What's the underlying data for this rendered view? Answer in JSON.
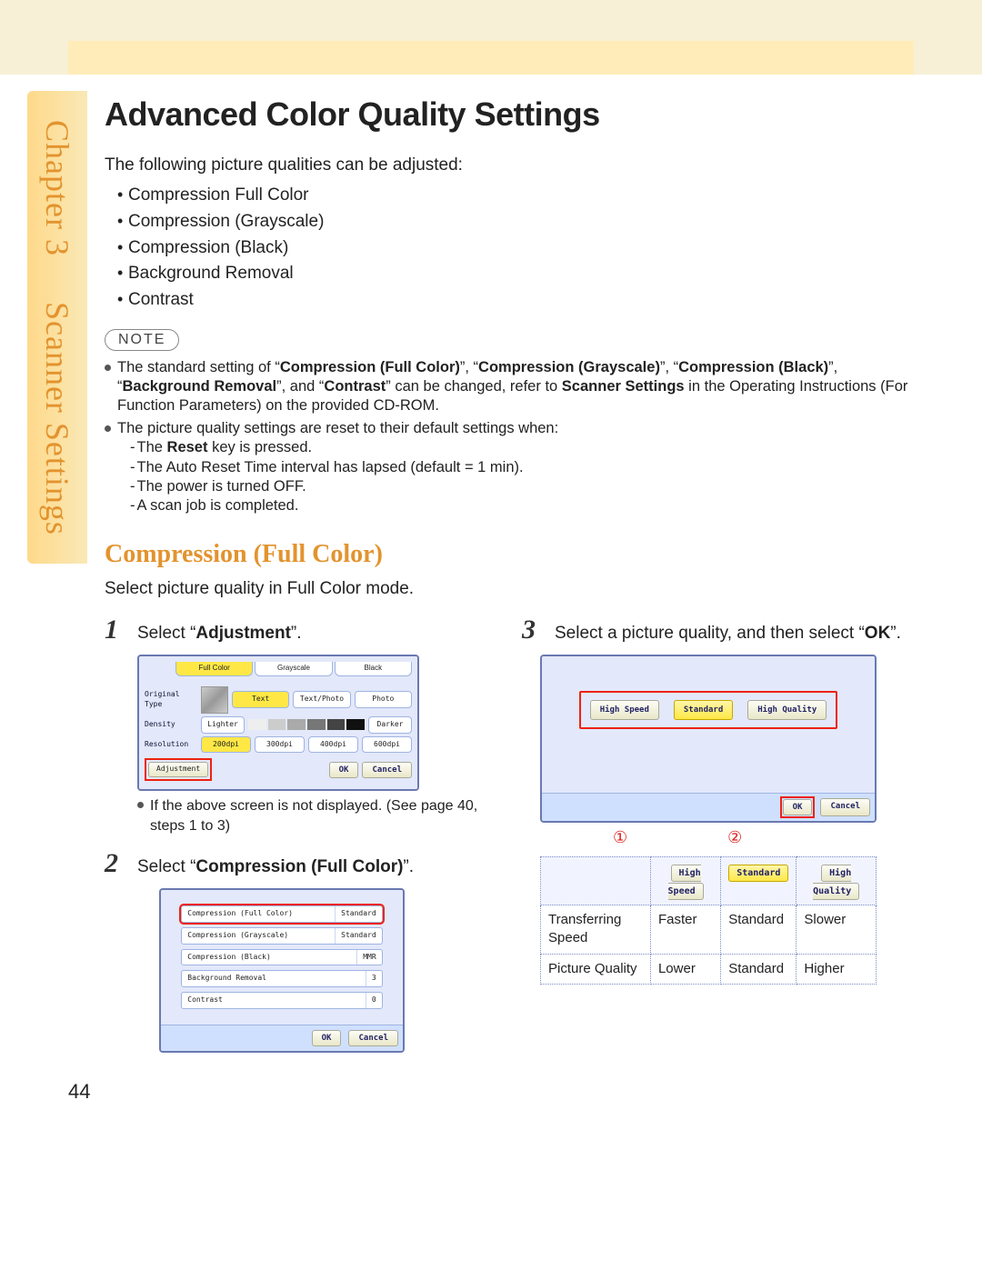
{
  "chapter": {
    "label": "Chapter 3",
    "section": "Scanner Settings"
  },
  "title": "Advanced Color Quality Settings",
  "intro": "The following picture qualities can be adjusted:",
  "quality_list": [
    "Compression Full Color",
    "Compression (Grayscale)",
    "Compression (Black)",
    "Background Removal",
    "Contrast"
  ],
  "note_label": "NOTE",
  "notes": {
    "n1_pre": "The standard setting of “",
    "b1": "Compression (Full Color)",
    "n1_mid1": "”, “",
    "b2": "Compression (Grayscale)",
    "n1_mid2": "”, “",
    "b3": "Compression (Black)",
    "n1_mid3": "”, “",
    "b4": "Background Removal",
    "n1_mid4": "”, and “",
    "b5": "Contrast",
    "n1_mid5": "” can be changed, refer to ",
    "b6": "Scanner Settings",
    "n1_post": " in the Operating Instructions (For Function Parameters) on the provided CD-ROM.",
    "n2_head": "The picture quality settings are reset to their default settings when:",
    "n2_a_pre": "The ",
    "n2_a_b": "Reset",
    "n2_a_post": " key is pressed.",
    "n2_b": "The Auto Reset Time interval has lapsed (default = 1 min).",
    "n2_c": "The power is turned OFF.",
    "n2_d": "A scan job is completed."
  },
  "section_title": "Compression (Full Color)",
  "section_lead": "Select picture quality in Full Color mode.",
  "steps": {
    "s1": {
      "num": "1",
      "pre": "Select “",
      "bold": "Adjustment",
      "post": "”."
    },
    "s1_sub": "If the above screen is not displayed. (See page 40, steps 1 to 3)",
    "s2": {
      "num": "2",
      "pre": "Select “",
      "bold": "Compression (Full Color)",
      "post": "”."
    },
    "s3": {
      "num": "3",
      "pre": "Select a picture quality, and then select “",
      "bold": "OK",
      "post": "”."
    }
  },
  "callouts": {
    "c1": "①",
    "c2": "②"
  },
  "screen1": {
    "tabs": {
      "full": "Full Color",
      "gray": "Grayscale",
      "black": "Black"
    },
    "labels": {
      "orig": "Original Type",
      "dens": "Density",
      "res": "Resolution",
      "adj": "Adjustment"
    },
    "chips": {
      "text": "Text",
      "tp": "Text/Photo",
      "photo": "Photo",
      "lighter": "Lighter",
      "darker": "Darker",
      "r200": "200dpi",
      "r300": "300dpi",
      "r400": "400dpi",
      "r600": "600dpi",
      "ok": "OK",
      "cancel": "Cancel"
    }
  },
  "screen2": {
    "items": {
      "cfc": {
        "l": "Compression (Full Color)",
        "r": "Standard"
      },
      "cgs": {
        "l": "Compression (Grayscale)",
        "r": "Standard"
      },
      "cb": {
        "l": "Compression (Black)",
        "r": "MMR"
      },
      "bg": {
        "l": "Background Removal",
        "r": "3"
      },
      "ct": {
        "l": "Contrast",
        "r": "0"
      }
    },
    "ok": "OK",
    "cancel": "Cancel"
  },
  "screen3": {
    "hs": "High Speed",
    "std": "Standard",
    "hq": "High Quality",
    "ok": "OK",
    "cancel": "Cancel"
  },
  "cmp": {
    "hdr": {
      "hs": "High Speed",
      "std": "Standard",
      "hq": "High Quality"
    },
    "r1": {
      "label": "Transferring Speed",
      "c1": "Faster",
      "c2": "Standard",
      "c3": "Slower"
    },
    "r2": {
      "label": "Picture Quality",
      "c1": "Lower",
      "c2": "Standard",
      "c3": "Higher"
    }
  },
  "page_number": "44"
}
